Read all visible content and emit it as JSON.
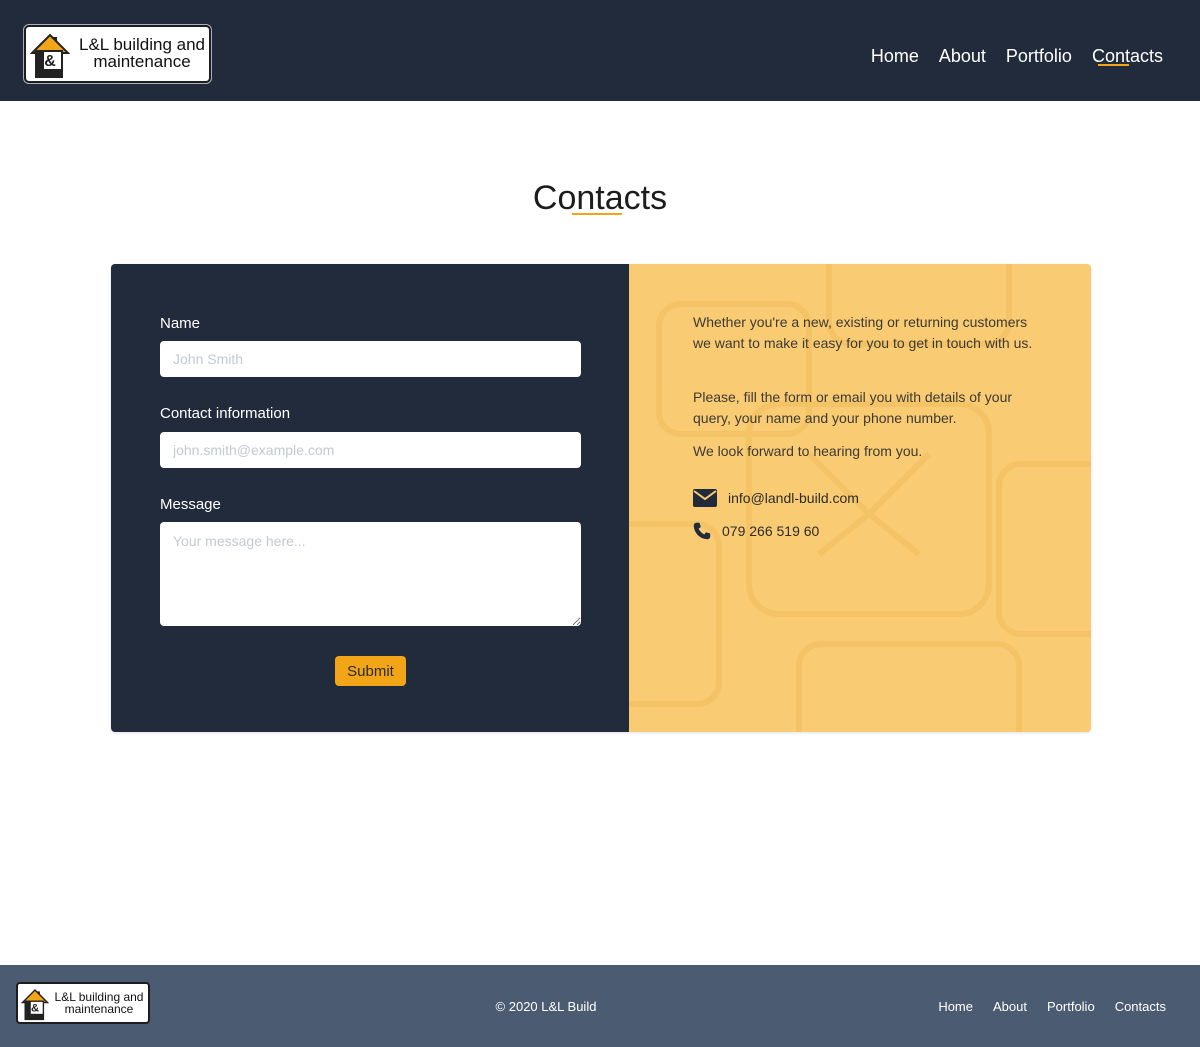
{
  "header": {
    "logo": {
      "mark": "&",
      "text_line1": "L&L building and",
      "text_line2": "maintenance"
    },
    "nav": [
      {
        "label": "Home"
      },
      {
        "label": "About"
      },
      {
        "label": "Portfolio"
      },
      {
        "label": "Contacts",
        "active": true
      }
    ]
  },
  "page": {
    "title": "Contacts"
  },
  "form": {
    "name_label": "Name",
    "name_placeholder": "John Smith",
    "contact_label": "Contact information",
    "contact_placeholder": "john.smith@example.com",
    "message_label": "Message",
    "message_placeholder": "Your message here...",
    "submit_label": "Submit"
  },
  "info": {
    "paragraph1": "Whether you're a new, existing or returning customers we want to make it easy for you to get in touch with us.",
    "paragraph2": "Please, fill the form or email you with details of your query, your name and your phone number.",
    "paragraph3": "We look forward to hearing from you.",
    "email": "info@landl-build.com",
    "phone": "079 266 519 60",
    "icons": [
      "envelope-icon",
      "phone-icon"
    ]
  },
  "footer": {
    "logo": {
      "mark": "&",
      "text_line1": "L&L building and",
      "text_line2": "maintenance"
    },
    "copyright": "© 2020 L&L Build",
    "nav": [
      {
        "label": "Home"
      },
      {
        "label": "About"
      },
      {
        "label": "Portfolio"
      },
      {
        "label": "Contacts"
      }
    ]
  },
  "colors": {
    "header_bg": "#222b3b",
    "accent": "#f2a516",
    "info_panel_bg": "#f9cb73",
    "footer_bg": "#4b5c72"
  }
}
